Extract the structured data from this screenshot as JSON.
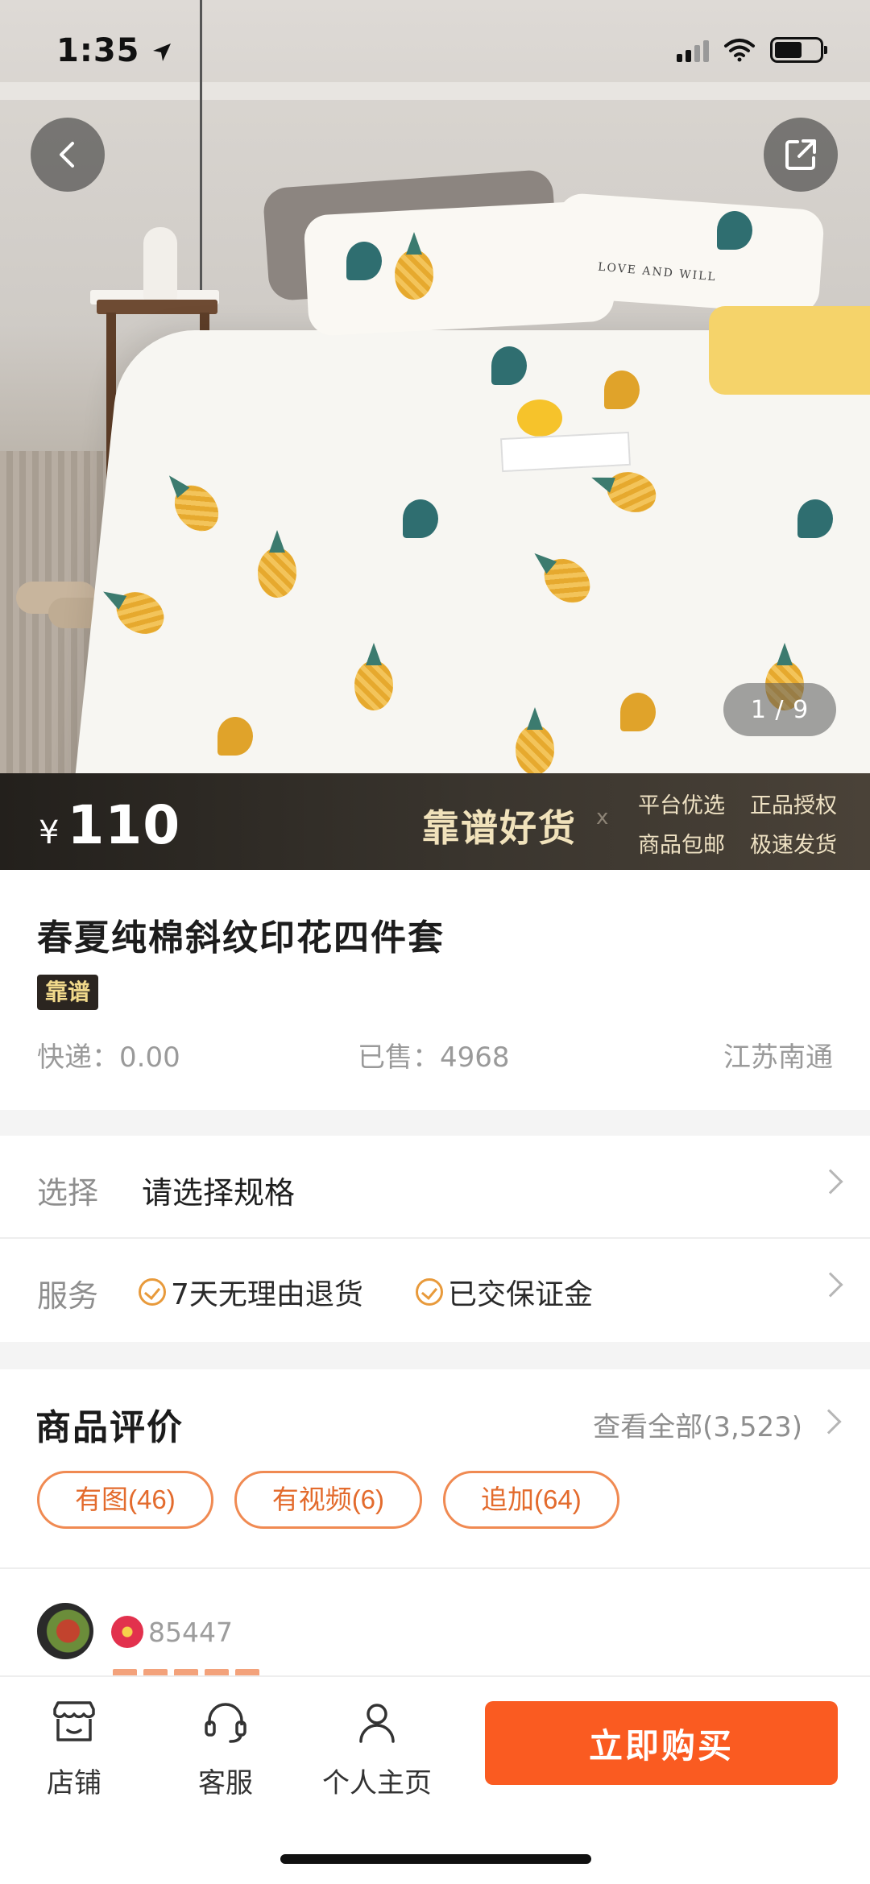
{
  "status_bar": {
    "time": "1:35"
  },
  "hero": {
    "image_counter": "1 / 9",
    "pillow_text": "LOVE AND WILL"
  },
  "price_banner": {
    "currency": "¥",
    "price": "110",
    "title": "靠谱好货",
    "separator": "x",
    "perks": [
      "平台优选",
      "正品授权",
      "商品包邮",
      "极速发货"
    ]
  },
  "product": {
    "title": "春夏纯棉斜纹印花四件套",
    "tag": "靠谱",
    "shipping": "快递：0.00",
    "sold": "已售：4968",
    "location": "江苏南通"
  },
  "options": {
    "select_label": "选择",
    "select_value": "请选择规格",
    "service_label": "服务",
    "services": [
      "7天无理由退货",
      "已交保证金"
    ]
  },
  "reviews": {
    "title": "商品评价",
    "view_all": "查看全部(3,523)",
    "chips": [
      "有图(46)",
      "有视频(6)",
      "追加(64)"
    ],
    "first_review": {
      "username": "85447",
      "rating": 5
    }
  },
  "bottom_bar": {
    "tabs": [
      {
        "label": "店铺",
        "icon": "store-icon"
      },
      {
        "label": "客服",
        "icon": "headset-icon"
      },
      {
        "label": "个人主页",
        "icon": "person-icon"
      }
    ],
    "buy_label": "立即购买"
  },
  "colors": {
    "accent": "#fa5b21",
    "chip_border": "#f08a52",
    "check": "#e89a3b",
    "banner_dark": "#23201c",
    "banner_gold": "#f1e2bb"
  }
}
